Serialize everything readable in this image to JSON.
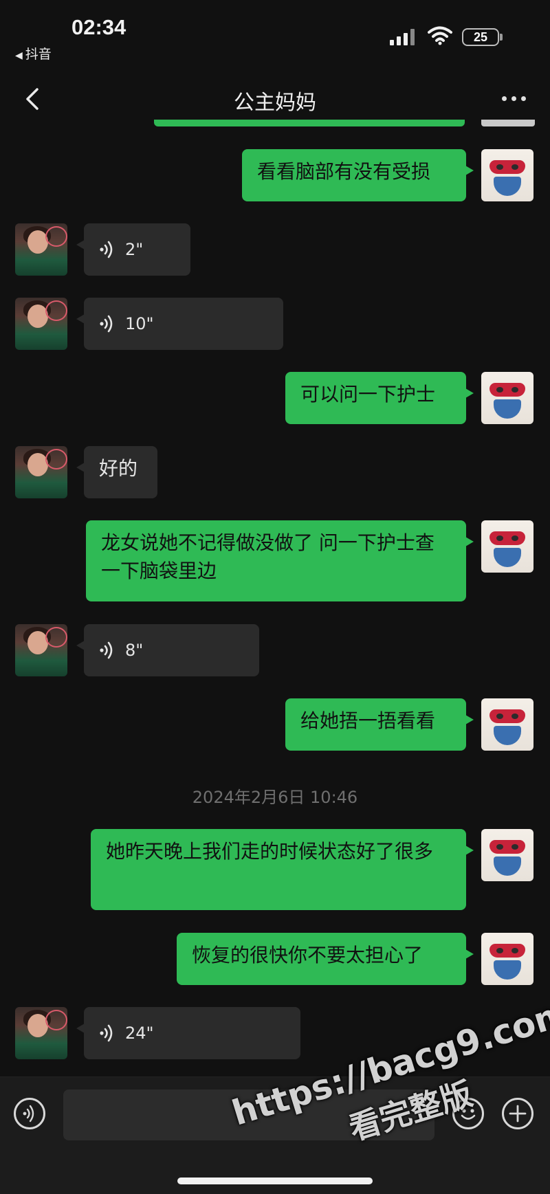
{
  "status_bar": {
    "time": "02:34",
    "back_app": "抖音",
    "battery": "25"
  },
  "header": {
    "title": "公主妈妈"
  },
  "messages": [
    {
      "from": "me",
      "type": "text",
      "text": "看看脑部有没有受损"
    },
    {
      "from": "them",
      "type": "voice",
      "duration": "2\""
    },
    {
      "from": "them",
      "type": "voice",
      "duration": "10\""
    },
    {
      "from": "me",
      "type": "text",
      "text": "可以问一下护士"
    },
    {
      "from": "them",
      "type": "text",
      "text": "好的"
    },
    {
      "from": "me",
      "type": "text",
      "text": "龙女说她不记得做没做了 问一下护士查一下脑袋里边"
    },
    {
      "from": "them",
      "type": "voice",
      "duration": "8\""
    },
    {
      "from": "me",
      "type": "text",
      "text": "给她捂一捂看看"
    },
    {
      "from": "me",
      "type": "text",
      "text": "她昨天晚上我们走的时候状态好了很多"
    },
    {
      "from": "me",
      "type": "text",
      "text": "恢复的很快你不要太担心了"
    },
    {
      "from": "them",
      "type": "voice",
      "duration": "24\""
    }
  ],
  "timestamp": "2024年2月6日 10:46",
  "icons": [
    "back-icon",
    "more-icon",
    "voice-wave-icon",
    "voice-mode-icon",
    "emoji-icon",
    "plus-icon",
    "signal-icon",
    "wifi-icon",
    "battery-icon"
  ],
  "watermark": {
    "url": "https://bacg9.com",
    "text": "看完整版"
  }
}
